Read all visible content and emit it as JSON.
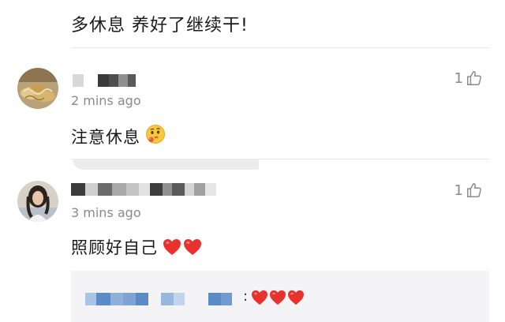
{
  "top_comment": {
    "text": "多休息 养好了继续干!"
  },
  "comments": [
    {
      "time": "2 mins ago",
      "like_count": "1",
      "text": "注意休息",
      "emoji": "thinking-face-emoji"
    },
    {
      "time": "3 mins ago",
      "like_count": "1",
      "text": "照顾好自己",
      "emoji": "red-heart-emoji x2"
    }
  ],
  "reply": {
    "separator": ":",
    "emoji": "red-heart-emoji x3"
  },
  "colors": {
    "heart": "#e8322f",
    "reply_name_blue": "#5b8cc8",
    "meta_gray": "#8a8a8a"
  }
}
